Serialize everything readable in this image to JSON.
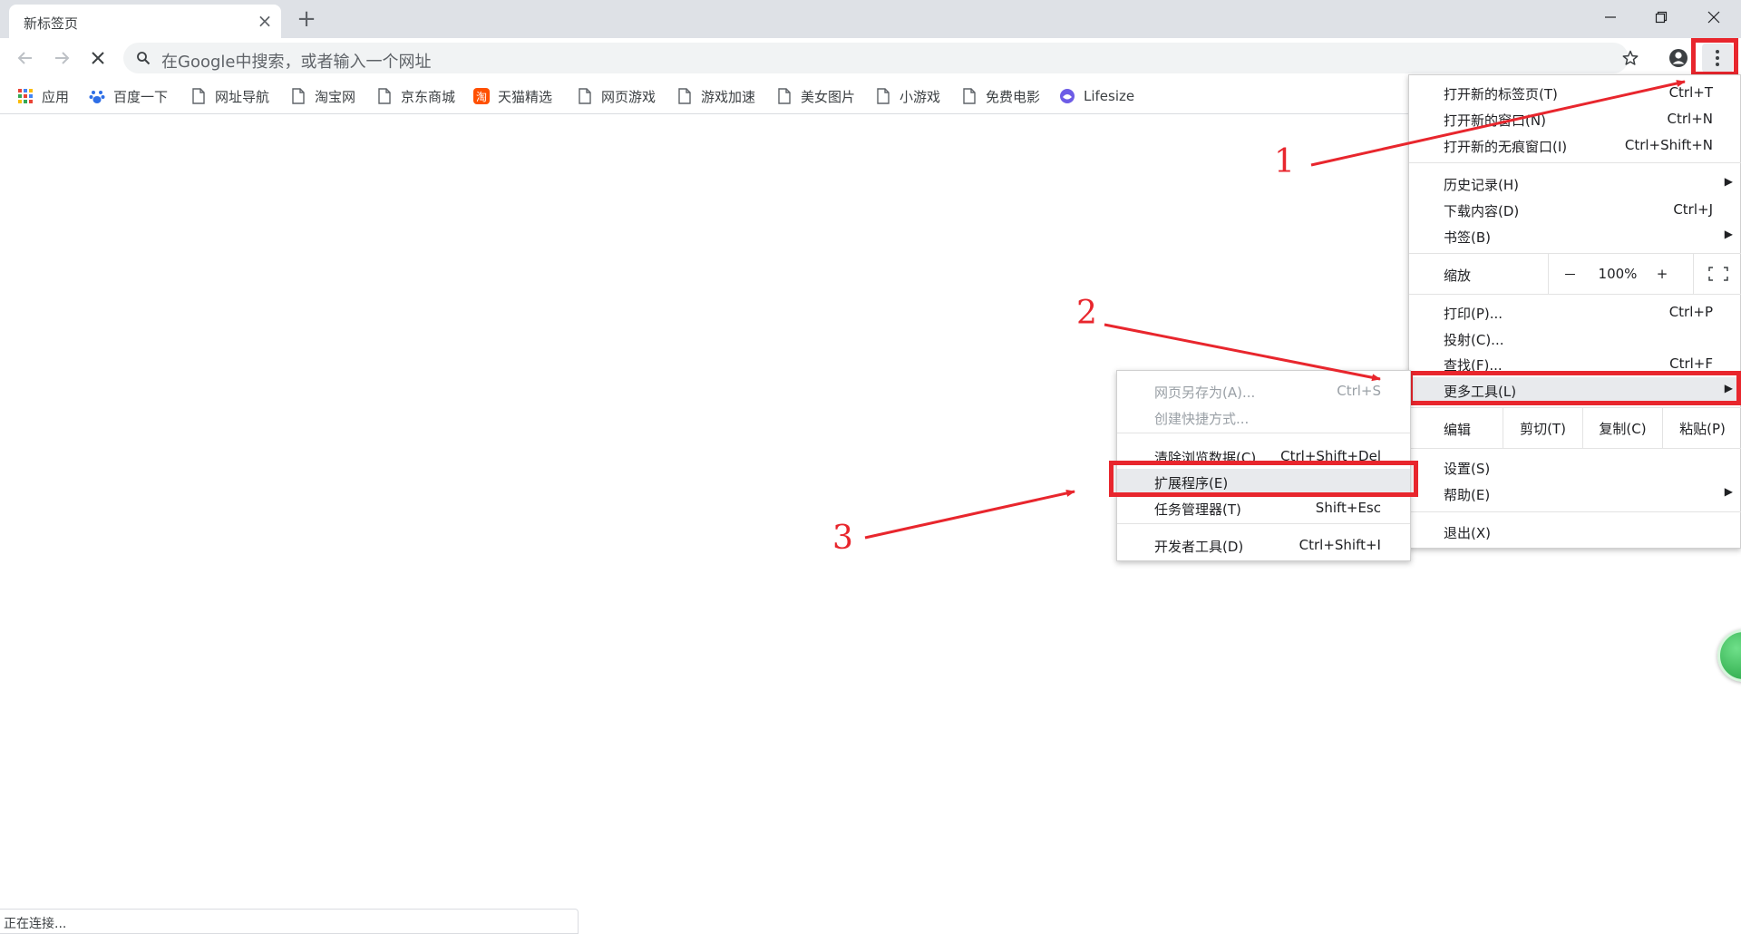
{
  "tab": {
    "title": "新标签页"
  },
  "omnibox": {
    "placeholder": "在Google中搜索，或者输入一个网址"
  },
  "bookmarks": [
    {
      "label": "应用",
      "icon": "apps-grid-icon"
    },
    {
      "label": "百度一下",
      "icon": "baidu-paw-icon"
    },
    {
      "label": "网址导航",
      "icon": "page-icon"
    },
    {
      "label": "淘宝网",
      "icon": "page-icon"
    },
    {
      "label": "京东商城",
      "icon": "page-icon"
    },
    {
      "label": "天猫精选",
      "icon": "taobao-icon"
    },
    {
      "label": "网页游戏",
      "icon": "page-icon"
    },
    {
      "label": "游戏加速",
      "icon": "page-icon"
    },
    {
      "label": "美女图片",
      "icon": "page-icon"
    },
    {
      "label": "小游戏",
      "icon": "page-icon"
    },
    {
      "label": "免费电影",
      "icon": "page-icon"
    },
    {
      "label": "Lifesize",
      "icon": "lifesize-icon"
    }
  ],
  "menu": {
    "new_tab": {
      "label": "打开新的标签页(T)",
      "shortcut": "Ctrl+T"
    },
    "new_window": {
      "label": "打开新的窗口(N)",
      "shortcut": "Ctrl+N"
    },
    "incognito": {
      "label": "打开新的无痕窗口(I)",
      "shortcut": "Ctrl+Shift+N"
    },
    "history": {
      "label": "历史记录(H)"
    },
    "downloads": {
      "label": "下载内容(D)",
      "shortcut": "Ctrl+J"
    },
    "bookmarks": {
      "label": "书签(B)"
    },
    "zoom": {
      "label": "缩放",
      "minus": "－",
      "value": "100%",
      "plus": "+"
    },
    "print": {
      "label": "打印(P)...",
      "shortcut": "Ctrl+P"
    },
    "cast": {
      "label": "投射(C)..."
    },
    "find": {
      "label": "查找(F)...",
      "shortcut": "Ctrl+F"
    },
    "more_tools": {
      "label": "更多工具(L)"
    },
    "edit": {
      "label": "编辑",
      "cut": "剪切(T)",
      "copy": "复制(C)",
      "paste": "粘贴(P)"
    },
    "settings": {
      "label": "设置(S)"
    },
    "help": {
      "label": "帮助(E)"
    },
    "exit": {
      "label": "退出(X)"
    }
  },
  "submenu": {
    "save_page": {
      "label": "网页另存为(A)...",
      "shortcut": "Ctrl+S"
    },
    "create_shortcut": {
      "label": "创建快捷方式..."
    },
    "clear_data": {
      "label": "清除浏览数据(C)...",
      "shortcut": "Ctrl+Shift+Del"
    },
    "extensions": {
      "label": "扩展程序(E)"
    },
    "task_manager": {
      "label": "任务管理器(T)",
      "shortcut": "Shift+Esc"
    },
    "devtools": {
      "label": "开发者工具(D)",
      "shortcut": "Ctrl+Shift+I"
    }
  },
  "annotations": {
    "step1": "1",
    "step2": "2",
    "step3": "3"
  },
  "status": {
    "text": "正在连接..."
  },
  "colors": {
    "highlight": "#e8262d",
    "annotation": "#e8262d",
    "tabstrip": "#dee1e6"
  }
}
